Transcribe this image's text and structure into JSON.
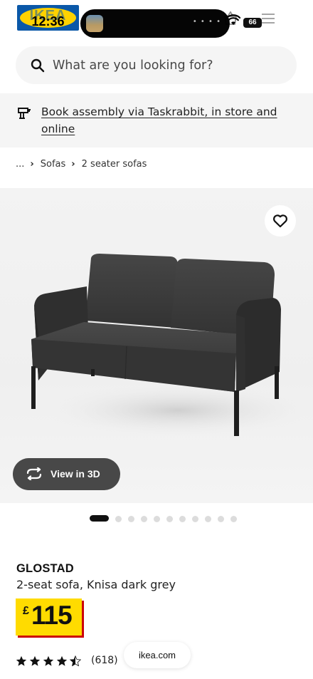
{
  "status_bar": {
    "time": "12:36",
    "battery": "66",
    "logo_text": "IKEA"
  },
  "search": {
    "placeholder": "What are you looking for?"
  },
  "banner": {
    "text": "Book assembly via Taskrabbit, in store and online"
  },
  "breadcrumb": {
    "ellipsis": "...",
    "items": [
      "Sofas",
      "2 seater sofas"
    ]
  },
  "gallery": {
    "view_3d_label": "View in 3D",
    "total_images": 11,
    "active_index": 0
  },
  "product": {
    "name": "GLOSTAD",
    "description": "2-seat sofa, Knisa dark grey",
    "currency": "£",
    "price": "115",
    "rating": 4.5,
    "rating_max": 5,
    "review_count": "(618)"
  },
  "browser": {
    "url": "ikea.com"
  },
  "colors": {
    "price_bg": "#ffdb00",
    "price_shadow": "#cc0008",
    "view3d_bg": "#484848"
  }
}
